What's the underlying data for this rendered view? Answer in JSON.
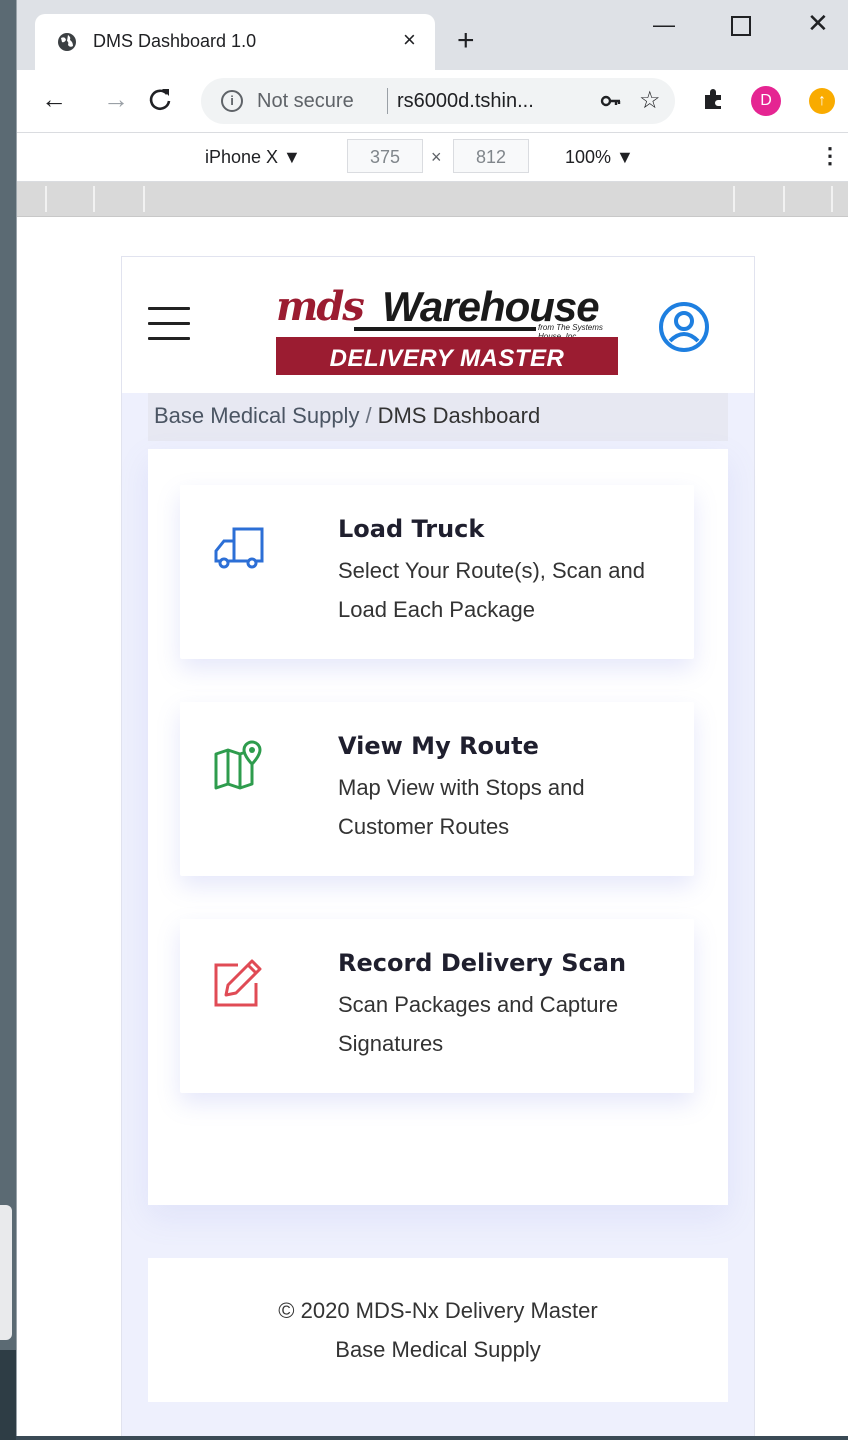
{
  "browser": {
    "tab_title": "DMS Dashboard 1.0",
    "tab_close": "×",
    "new_tab": "+",
    "not_secure": "Not secure",
    "url": "rs6000d.tshin...",
    "profile_initial": "D"
  },
  "device_toolbar": {
    "device": "iPhone X ▼",
    "width": "375",
    "times": "×",
    "height": "812",
    "zoom": "100% ▼"
  },
  "header": {
    "logo_mds": "mds",
    "logo_warehouse": "Warehouse",
    "logo_from": "from The Systems House, Inc.",
    "logo_banner": "DELIVERY MASTER"
  },
  "breadcrumb": {
    "parent": "Base Medical Supply",
    "separator": "/",
    "current": "DMS Dashboard"
  },
  "cards": [
    {
      "title": "Load Truck",
      "desc": "Select Your Route(s), Scan and Load Each Package",
      "icon": "truck-icon",
      "color": "#2c6fd6"
    },
    {
      "title": "View My Route",
      "desc": "Map View with Stops and Customer Routes",
      "icon": "map-icon",
      "color": "#2e9c4d"
    },
    {
      "title": "Record Delivery Scan",
      "desc": "Scan Packages and Capture Signatures",
      "icon": "edit-icon",
      "color": "#e04b55"
    }
  ],
  "footer": {
    "line1": "© 2020 MDS-Nx Delivery Master",
    "line2": "Base Medical Supply"
  },
  "colors": {
    "brand_red": "#9b1c31",
    "user_icon": "#1e7fe0"
  }
}
